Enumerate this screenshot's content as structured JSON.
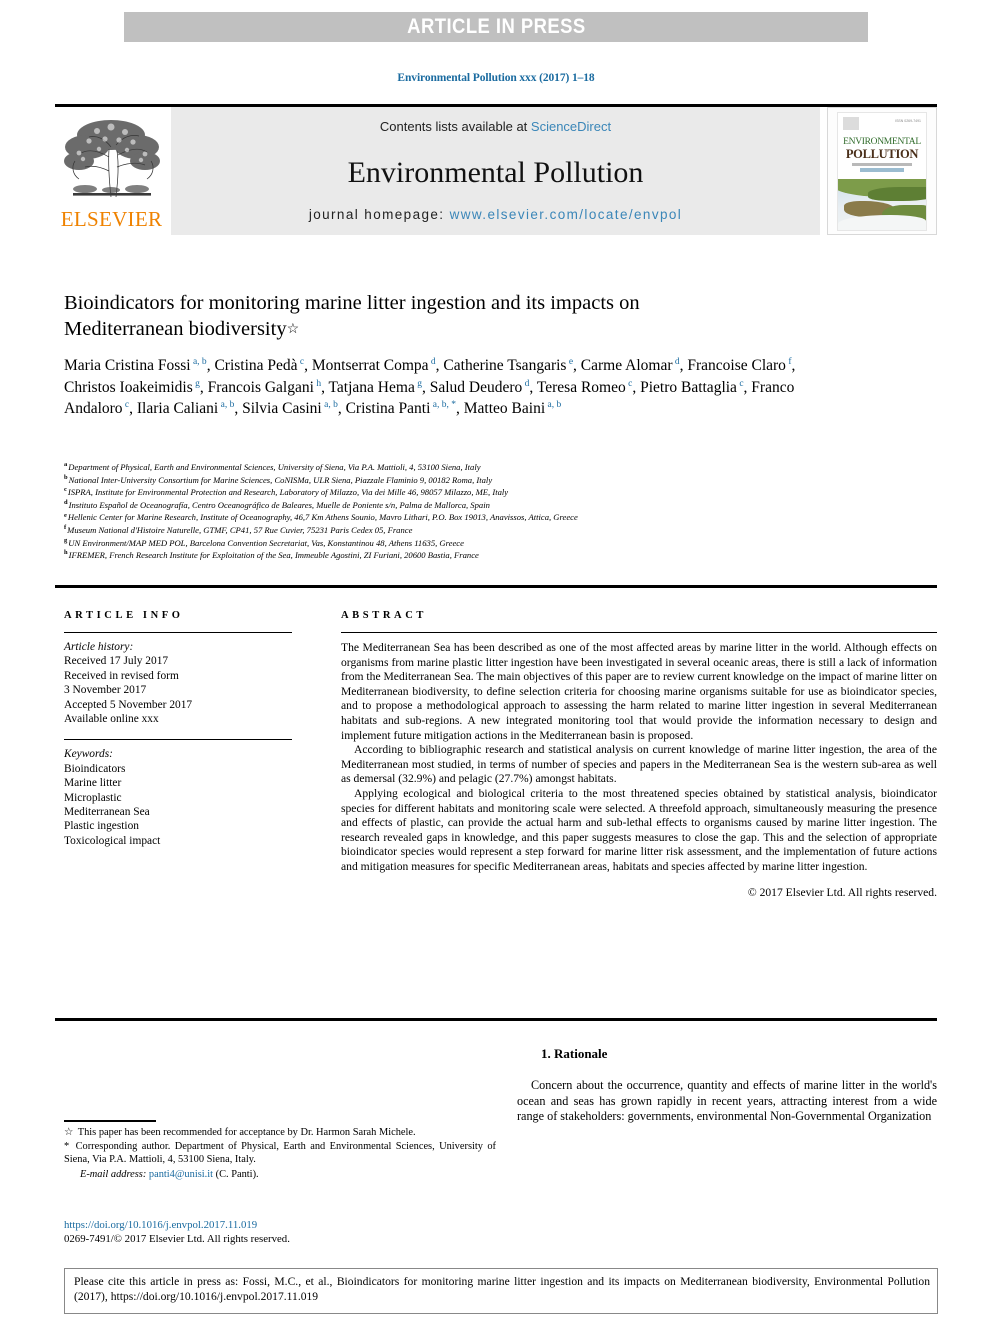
{
  "banner": {
    "text": "ARTICLE IN PRESS"
  },
  "running_head": "Environmental Pollution xxx (2017) 1–18",
  "masthead": {
    "contents_prefix": "Contents lists available at ",
    "sciencedirect": "ScienceDirect",
    "journal_title": "Environmental Pollution",
    "homepage_label": "journal homepage: ",
    "homepage_url": "www.elsevier.com/locate/envpol",
    "publisher": "ELSEVIER",
    "cover": {
      "line1": "ENVIRONMENTAL",
      "line2": "POLLUTION",
      "issn": "ISSN 0269-7491"
    }
  },
  "article": {
    "title": "Bioindicators for monitoring marine litter ingestion and its impacts on Mediterranean biodiversity",
    "title_mark": "☆",
    "authors": [
      {
        "name": "Maria Cristina Fossi",
        "marks": "a, b",
        "sep": ", "
      },
      {
        "name": "Cristina Pedà",
        "marks": "c",
        "sep": ", "
      },
      {
        "name": "Montserrat Compa",
        "marks": "d",
        "sep": ", "
      },
      {
        "name": "Catherine Tsangaris",
        "marks": "e",
        "sep": ", "
      },
      {
        "name": "Carme Alomar",
        "marks": "d",
        "sep": ", "
      },
      {
        "name": "Francoise Claro",
        "marks": "f",
        "sep": ", "
      },
      {
        "name": "Christos Ioakeimidis",
        "marks": "g",
        "sep": ", "
      },
      {
        "name": "Francois Galgani",
        "marks": "h",
        "sep": ", "
      },
      {
        "name": "Tatjana Hema",
        "marks": "g",
        "sep": ", "
      },
      {
        "name": "Salud Deudero",
        "marks": "d",
        "sep": ", "
      },
      {
        "name": "Teresa Romeo",
        "marks": "c",
        "sep": ", "
      },
      {
        "name": "Pietro Battaglia",
        "marks": "c",
        "sep": ", "
      },
      {
        "name": "Franco Andaloro",
        "marks": "c",
        "sep": ", "
      },
      {
        "name": "Ilaria Caliani",
        "marks": "a, b",
        "sep": ", "
      },
      {
        "name": "Silvia Casini",
        "marks": "a, b",
        "sep": ", "
      },
      {
        "name": "Cristina Panti",
        "marks": "a, b, *",
        "sep": ", "
      },
      {
        "name": "Matteo Baini",
        "marks": "a, b",
        "sep": ""
      }
    ],
    "affiliations": [
      {
        "mark": "a",
        "text": "Department of Physical, Earth and Environmental Sciences, University of Siena, Via P.A. Mattioli, 4, 53100 Siena, Italy"
      },
      {
        "mark": "b",
        "text": "National Inter-University Consortium for Marine Sciences, CoNISMa, ULR Siena, Piazzale Flaminio 9, 00182 Roma, Italy"
      },
      {
        "mark": "c",
        "text": "ISPRA, Institute for Environmental Protection and Research, Laboratory of Milazzo, Via dei Mille 46, 98057 Milazzo, ME, Italy"
      },
      {
        "mark": "d",
        "text": "Instituto Español de Oceanografía, Centro Oceanográfico de Baleares, Muelle de Poniente s/n, Palma de Mallorca, Spain"
      },
      {
        "mark": "e",
        "text": "Hellenic Center for Marine Research, Institute of Oceanography, 46,7 Km Athens Sounio, Mavro Lithari, P.O. Box 19013, Anavissos, Attica, Greece"
      },
      {
        "mark": "f",
        "text": "Museum National d'Histoire Naturelle, GTMF, CP41, 57 Rue Cuvier, 75231 Paris Cedex 05, France"
      },
      {
        "mark": "g",
        "text": "UN Environment/MAP MED POL, Barcelona Convention Secretariat, Vas, Konstantinou 48, Athens 11635, Greece"
      },
      {
        "mark": "h",
        "text": "IFREMER, French Research Institute for Exploitation of the Sea, Immeuble Agostini, ZI Furiani, 20600 Bastia, France"
      }
    ]
  },
  "article_info": {
    "heading": "ARTICLE INFO",
    "history_label": "Article history:",
    "history": [
      "Received 17 July 2017",
      "Received in revised form",
      "3 November 2017",
      "Accepted 5 November 2017",
      "Available online xxx"
    ],
    "keywords_label": "Keywords:",
    "keywords": [
      "Bioindicators",
      "Marine litter",
      "Microplastic",
      "Mediterranean Sea",
      "Plastic ingestion",
      "Toxicological impact"
    ]
  },
  "abstract": {
    "heading": "ABSTRACT",
    "paragraphs": [
      "The Mediterranean Sea has been described as one of the most affected areas by marine litter in the world. Although effects on organisms from marine plastic litter ingestion have been investigated in several oceanic areas, there is still a lack of information from the Mediterranean Sea. The main objectives of this paper are to review current knowledge on the impact of marine litter on Mediterranean biodiversity, to define selection criteria for choosing marine organisms suitable for use as bioindicator species, and to propose a methodological approach to assessing the harm related to marine litter ingestion in several Mediterranean habitats and sub-regions. A new integrated monitoring tool that would provide the information necessary to design and implement future mitigation actions in the Mediterranean basin is proposed.",
      "According to bibliographic research and statistical analysis on current knowledge of marine litter ingestion, the area of the Mediterranean most studied, in terms of number of species and papers in the Mediterranean Sea is the western sub-area as well as demersal (32.9%) and pelagic (27.7%) amongst habitats.",
      "Applying ecological and biological criteria to the most threatened species obtained by statistical analysis, bioindicator species for different habitats and monitoring scale were selected. A threefold approach, simultaneously measuring the presence and effects of plastic, can provide the actual harm and sub-lethal effects to organisms caused by marine litter ingestion. The research revealed gaps in knowledge, and this paper suggests measures to close the gap. This and the selection of appropriate bioindicator species would represent a step forward for marine litter risk assessment, and the implementation of future actions and mitigation measures for specific Mediterranean areas, habitats and species affected by marine litter ingestion."
    ],
    "copyright": "© 2017 Elsevier Ltd. All rights reserved."
  },
  "section": {
    "number_title": "1. Rationale",
    "body": "Concern about the occurrence, quantity and effects of marine litter in the world's ocean and seas has grown rapidly in recent years, attracting interest from a wide range of stakeholders: governments, environmental Non-Governmental Organization"
  },
  "footnotes": {
    "star_mark": "☆",
    "star_text": "This paper has been recommended for acceptance by Dr. Harmon Sarah Michele.",
    "corr_mark": "*",
    "corr_text": "Corresponding author. Department of Physical, Earth and Environmental Sciences, University of Siena, Via P.A. Mattioli, 4, 53100 Siena, Italy.",
    "email_label": "E-mail address:",
    "email": "panti4@unisi.it",
    "email_suffix": "(C. Panti).",
    "doi": "https://doi.org/10.1016/j.envpol.2017.11.019",
    "issn_line": "0269-7491/© 2017 Elsevier Ltd. All rights reserved."
  },
  "citation_footer": {
    "text": "Please cite this article in press as: Fossi, M.C., et al., Bioindicators for monitoring marine litter ingestion and its impacts on Mediterranean biodiversity, Environmental Pollution (2017), https://doi.org/10.1016/j.envpol.2017.11.019"
  },
  "colors": {
    "banner_bg": "#c0c0c0",
    "link_blue": "#1a6ba0",
    "sciencedirect_blue": "#3a86b8",
    "elsevier_orange": "#ef8200",
    "masthead_bg": "#eaeaea"
  }
}
